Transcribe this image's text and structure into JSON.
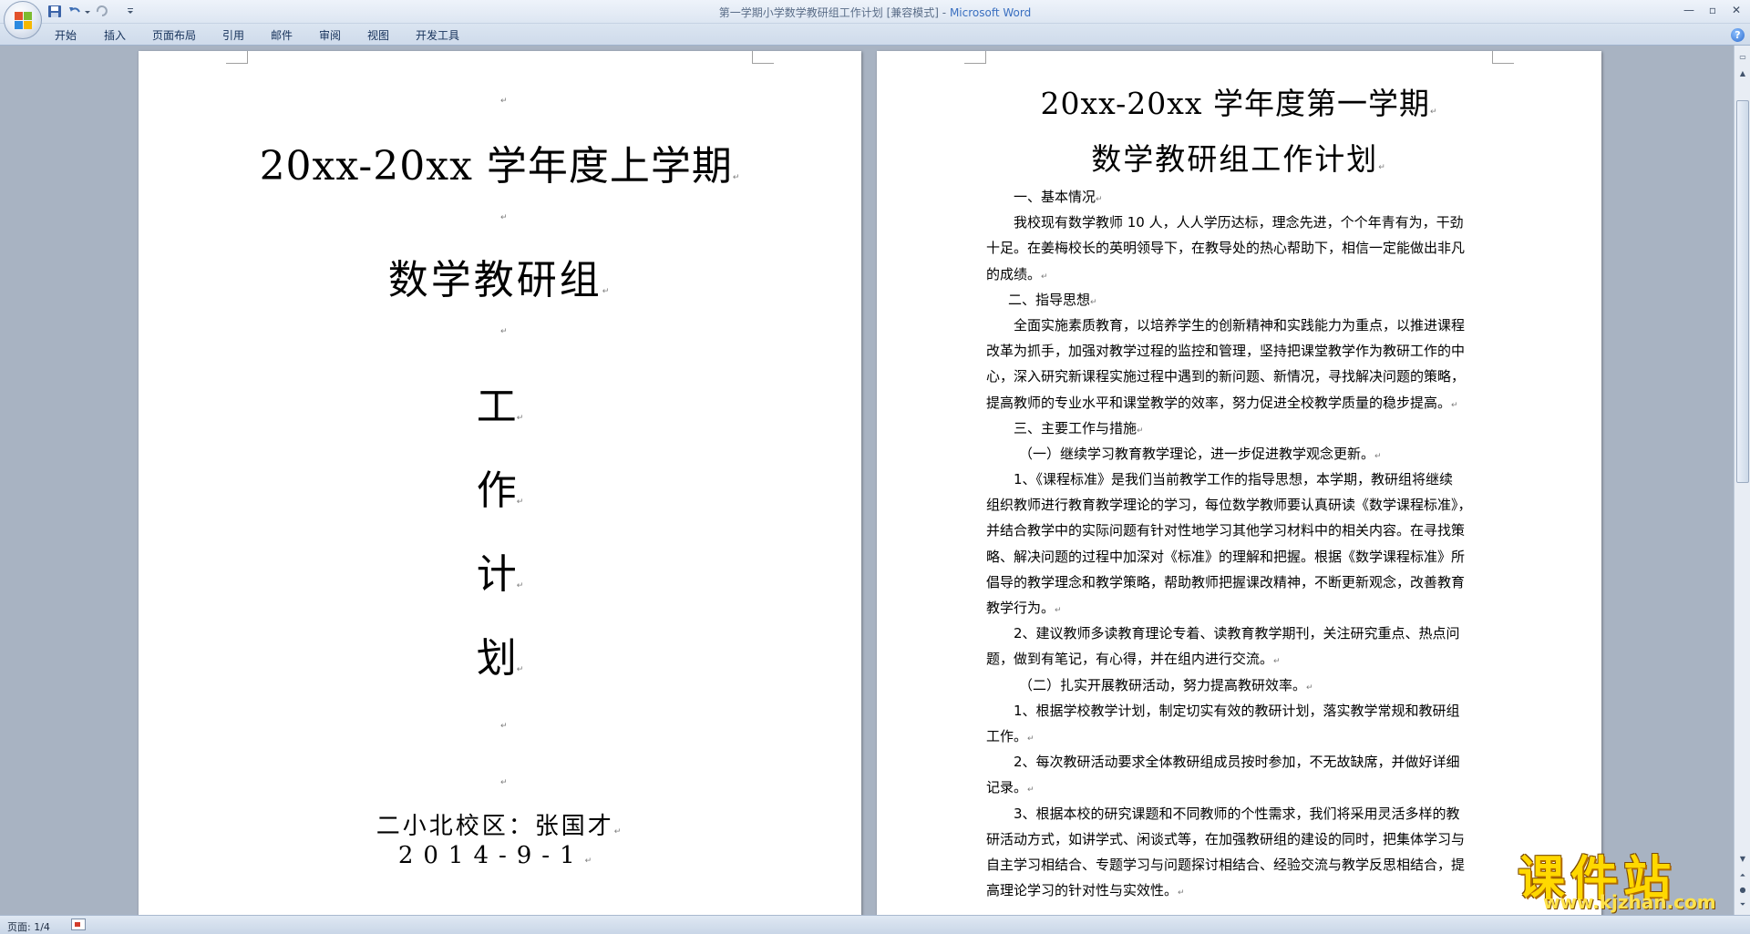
{
  "window": {
    "title": "第一学期小学数学教研组工作计划 [兼容模式]",
    "title_sep": " - ",
    "app": "Microsoft Word",
    "min_glyph": "—",
    "max_glyph": "▫",
    "close_glyph": "✕"
  },
  "ribbon": {
    "tabs": [
      "开始",
      "插入",
      "页面布局",
      "引用",
      "邮件",
      "审阅",
      "视图",
      "开发工具"
    ],
    "help_glyph": "?"
  },
  "page1": {
    "title_line1": "20xx-20xx 学年度上学期",
    "title_line2": "数学教研组",
    "vertical_chars": [
      "工",
      "作",
      "计",
      "划"
    ],
    "author": "二小北校区：张国才",
    "date": "2014-9-1"
  },
  "page2": {
    "title_line1": "20xx-20xx 学年度第一学期",
    "title_line2": "数学教研组工作计划",
    "lines": [
      "一、基本情况",
      "我校现有数学教师 10 人，人人学历达标，理念先进，个个年青有为，干劲",
      "十足。在姜梅校长的英明领导下，在教导处的热心帮助下，相信一定能做出非凡",
      "的成绩。",
      "二、指导思想",
      "全面实施素质教育，以培养学生的创新精神和实践能力为重点，以推进课程",
      "改革为抓手，加强对教学过程的监控和管理，坚持把课堂教学作为教研工作的中",
      "心，深入研究新课程实施过程中遇到的新问题、新情况，寻找解决问题的策略，",
      "提高教师的专业水平和课堂教学的效率，努力促进全校教学质量的稳步提高。",
      "三、主要工作与措施",
      "（一）继续学习教育教学理论，进一步促进教学观念更新。",
      "1、《课程标准》是我们当前教学工作的指导思想，本学期，教研组将继续",
      "组织教师进行教育教学理论的学习，每位数学教师要认真研读《数学课程标准》，",
      "并结合教学中的实际问题有针对性地学习其他学习材料中的相关内容。在寻找策",
      "略、解决问题的过程中加深对《标准》的理解和把握。根据《数学课程标准》所",
      "倡导的教学理念和教学策略，帮助教师把握课改精神，不断更新观念，改善教育",
      "教学行为。",
      "2、建议教师多读教育理论专着、读教育教学期刊，关注研究重点、热点问",
      "题，做到有笔记，有心得，并在组内进行交流。",
      "（二）扎实开展教研活动，努力提高教研效率。",
      "1、根据学校教学计划，制定切实有效的教研计划，落实教学常规和教研组",
      "工作。",
      "2、每次教研活动要求全体教研组成员按时参加，不无故缺席，并做好详细",
      "记录。",
      "3、根据本校的研究课题和不同教师的个性需求，我们将采用灵活多样的教",
      "研活动方式，如讲学式、闲谈式等，在加强教研组的建设的同时，把集体学习与",
      "自主学习相结合、专题学习与问题探讨相结合、经验交流与教学反思相结合，提",
      "高理论学习的针对性与实效性。"
    ]
  },
  "paragraph_mark": "↵",
  "status": {
    "page_info": "页面: 1/4"
  },
  "watermark": {
    "title": "课件站",
    "url": "www.kjzhan.com"
  },
  "colors": {
    "workspace": "#a8b3c2",
    "ribbon": "#dbe5f1",
    "app_title": "#3a6fc0",
    "watermark_yellow": "#ffd800"
  }
}
